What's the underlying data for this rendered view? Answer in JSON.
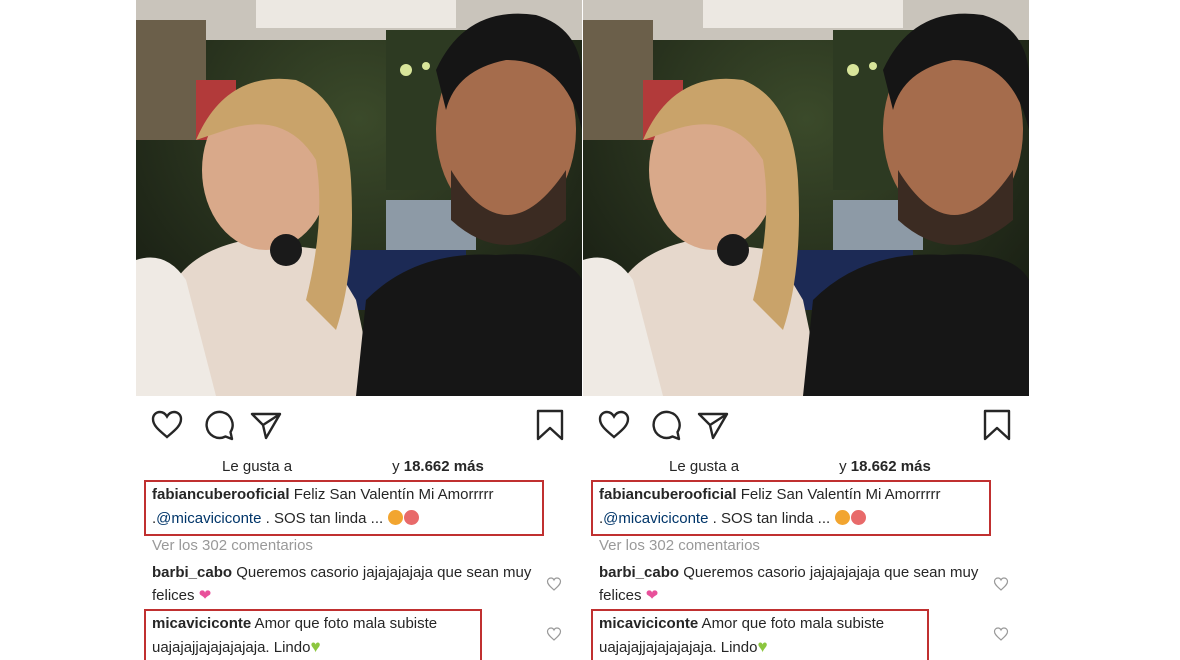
{
  "posts": [
    {
      "likes": {
        "prefix": "Le gusta a",
        "suffix_y": "y",
        "count": "18.662 más"
      },
      "caption": {
        "username": "fabiancuberooficial",
        "text_before": " Feliz San Valentín Mi Amorrrrr .",
        "mention": "@micaviciconte",
        "text_after": " . SOS tan linda ... "
      },
      "view_comments": "Ver los 302 comentarios",
      "comments": [
        {
          "username": "barbi_cabo",
          "text": " Queremos casorio jajajajajaja que sean muy felices "
        },
        {
          "username": "micaviciconte",
          "text": " Amor que foto mala subiste uajajajjajajajajaja. Lindo"
        }
      ]
    },
    {
      "likes": {
        "prefix": "Le gusta a",
        "suffix_y": "y",
        "count": "18.662 más"
      },
      "caption": {
        "username": "fabiancuberooficial",
        "text_before": " Feliz San Valentín Mi Amorrrrr .",
        "mention": "@micaviciconte",
        "text_after": " . SOS tan linda ... "
      },
      "view_comments": "Ver los 302 comentarios",
      "comments": [
        {
          "username": "barbi_cabo",
          "text": " Queremos casorio jajajajajaja que sean muy felices "
        },
        {
          "username": "micaviciconte",
          "text": " Amor que foto mala subiste uajajajjajajajajaja. Lindo"
        }
      ]
    }
  ],
  "icons": [
    "heart-icon",
    "comment-icon",
    "share-icon",
    "bookmark-icon",
    "comment-like-heart-icon"
  ],
  "colors": {
    "highlight_border": "#c03030",
    "text": "#262626",
    "muted": "#999999",
    "mention": "#003569",
    "pink_heart": "#e8509a",
    "green_heart": "#8cc63f"
  }
}
